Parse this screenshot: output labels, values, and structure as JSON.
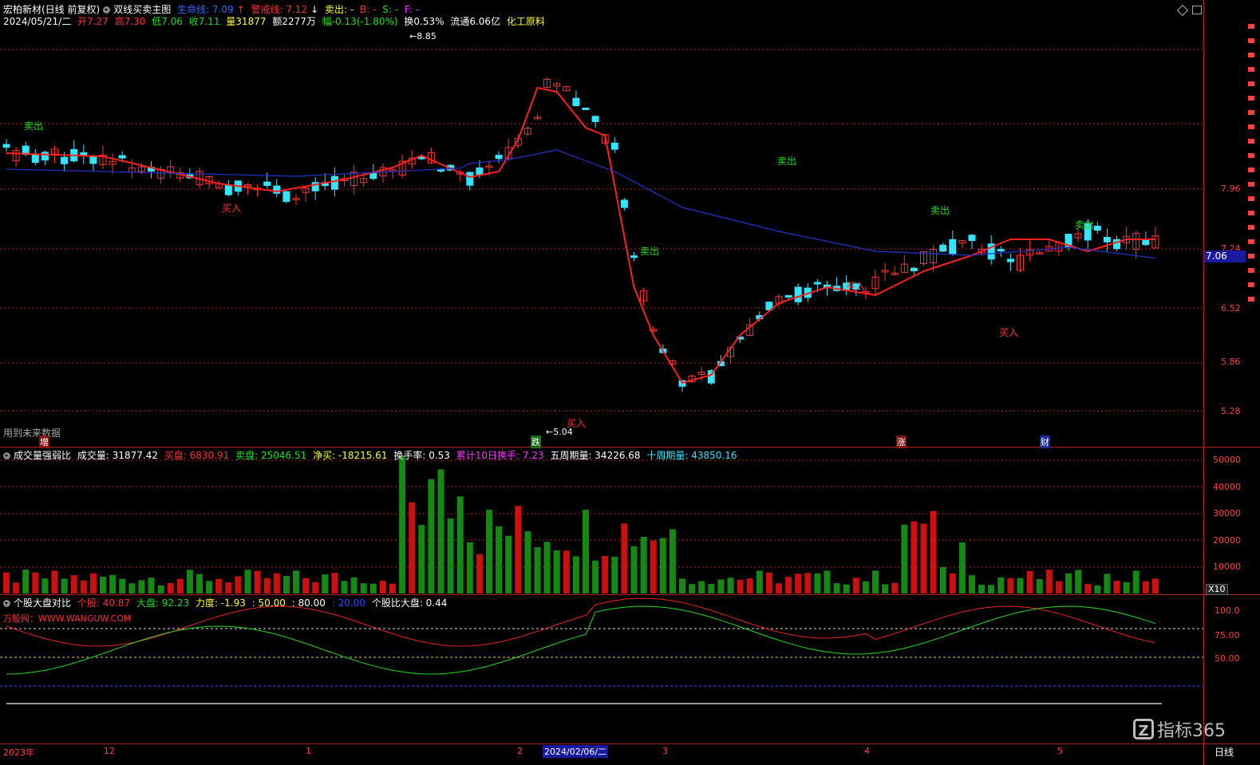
{
  "header": {
    "stock_name": "宏柏新材(日线 前复权)",
    "indicator_name": "双线买卖主图",
    "lifeline_label": "生命线: 7.09",
    "warning_label": "警戒线: 7.12",
    "warning_arrow": "↓",
    "sell_label": "卖出: -",
    "b_label": "B: -",
    "s_label": "S: -",
    "f_label": "F: -",
    "date": "2024/05/21/二",
    "open": "开7.27",
    "high": "高7.30",
    "low": "低7.06",
    "close": "收7.11",
    "volume": "量31877",
    "amount": "额2277万",
    "change": "幅-0.13(-1.80%)",
    "turnover": "换0.53%",
    "float_cap": "流通6.06亿",
    "sector": "化工原料"
  },
  "main_chart": {
    "price_ticks": [
      "7.96",
      "7.24",
      "6.52",
      "5.86",
      "5.28"
    ],
    "current_price_tag": "7.06",
    "future_data_note": "用到未来数据",
    "high_marker": "8.85",
    "low_marker": "5.04",
    "signal_sell": "卖出",
    "signal_buy": "买入",
    "event_marks": [
      "增",
      "跌",
      "涨",
      "财"
    ]
  },
  "volume_panel": {
    "title": "成交量强弱比",
    "vol": "成交量: 31877.42",
    "buy": "买盘: 6830.91",
    "sell": "卖盘: 25046.51",
    "net": "净买: -18215.61",
    "turnover": "换手率: 0.53",
    "cum10": "累计10日换手: 7.23",
    "wk5": "五周期量: 34226.68",
    "wk10": "十周期量: 43850.16",
    "ticks": [
      "50000",
      "40000",
      "30000",
      "20000",
      "10000"
    ],
    "multiplier": "X10"
  },
  "compare_panel": {
    "title": "个股大盘对比",
    "stock": "个股: 40.87",
    "market": "大盘: 92.23",
    "force": "力度: -1.93",
    "l50": ": 50.00",
    "l80": ": 80.00",
    "l20": ": 20.00",
    "ratio": "个股比大盘: 0.44",
    "watermark": "万股网：WWW.WANGUW.COM",
    "ticks": [
      "100.0",
      "75.00",
      "50.00"
    ]
  },
  "time_axis": {
    "labels": [
      "2023年",
      "12",
      "1",
      "2",
      "2024/02/06/二",
      "3",
      "4",
      "5"
    ],
    "period": "日线"
  },
  "brand": {
    "logo_text": "指标365"
  },
  "colors": {
    "up": "#ff3333",
    "down": "#33e5ff",
    "ma_long": "#2233cc",
    "line_up": "#ff2020",
    "line_down": "#22dd22",
    "grid": "#b22222"
  }
}
